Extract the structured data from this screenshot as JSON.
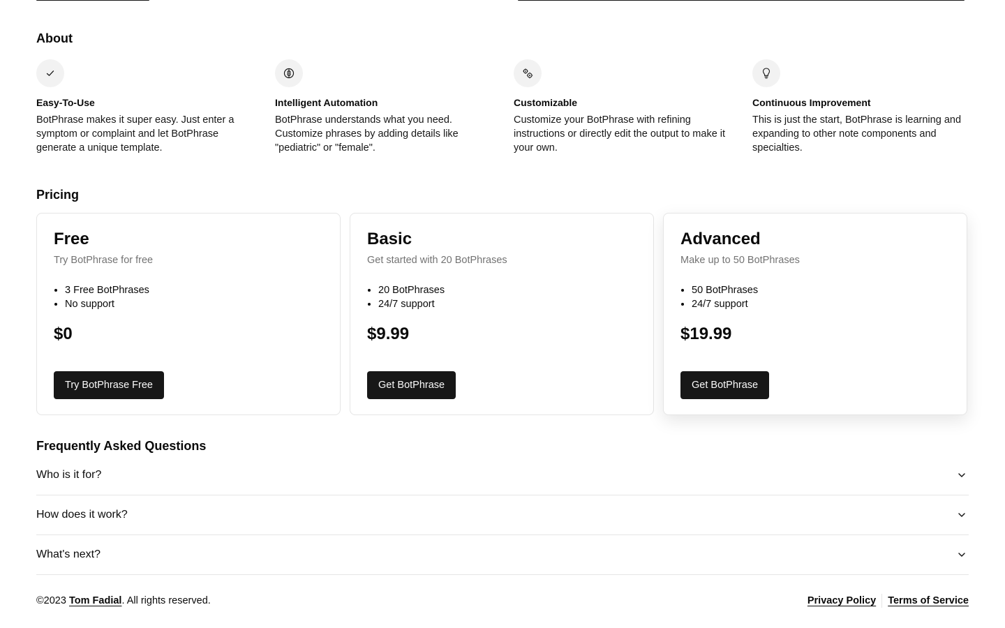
{
  "about": {
    "title": "About",
    "features": [
      {
        "icon": "check-icon",
        "title": "Easy-To-Use",
        "text": "BotPhrase makes it super easy. Just enter a symptom or complaint and let BotPhrase generate a unique template."
      },
      {
        "icon": "brain-icon",
        "title": "Intelligent Automation",
        "text": "BotPhrase understands what you need. Customize phrases by adding details like \"pediatric\" or \"female\"."
      },
      {
        "icon": "cogs-icon",
        "title": "Customizable",
        "text": "Customize your BotPhrase with refining instructions or directly edit the output to make it your own."
      },
      {
        "icon": "lightbulb-icon",
        "title": "Continuous Improvement",
        "text": "This is just the start, BotPhrase is learning and expanding to other note components and specialties."
      }
    ]
  },
  "pricing": {
    "title": "Pricing",
    "plans": [
      {
        "name": "Free",
        "description": "Try BotPhrase for free",
        "features": [
          "3 Free BotPhrases",
          "No support"
        ],
        "price": "$0",
        "button": "Try BotPhrase Free"
      },
      {
        "name": "Basic",
        "description": "Get started with 20 BotPhrases",
        "features": [
          "20 BotPhrases",
          "24/7 support"
        ],
        "price": "$9.99",
        "button": "Get BotPhrase"
      },
      {
        "name": "Advanced",
        "description": "Make up to 50 BotPhrases",
        "features": [
          "50 BotPhrases",
          "24/7 support"
        ],
        "price": "$19.99",
        "button": "Get BotPhrase"
      }
    ]
  },
  "faq": {
    "title": "Frequently Asked Questions",
    "items": [
      {
        "question": "Who is it for?"
      },
      {
        "question": "How does it work?"
      },
      {
        "question": "What's next?"
      }
    ]
  },
  "footer": {
    "copyright_prefix": "©2023 ",
    "author": "Tom Fadial",
    "copyright_suffix": ". All rights reserved.",
    "privacy": "Privacy Policy",
    "terms": "Terms of Service"
  }
}
